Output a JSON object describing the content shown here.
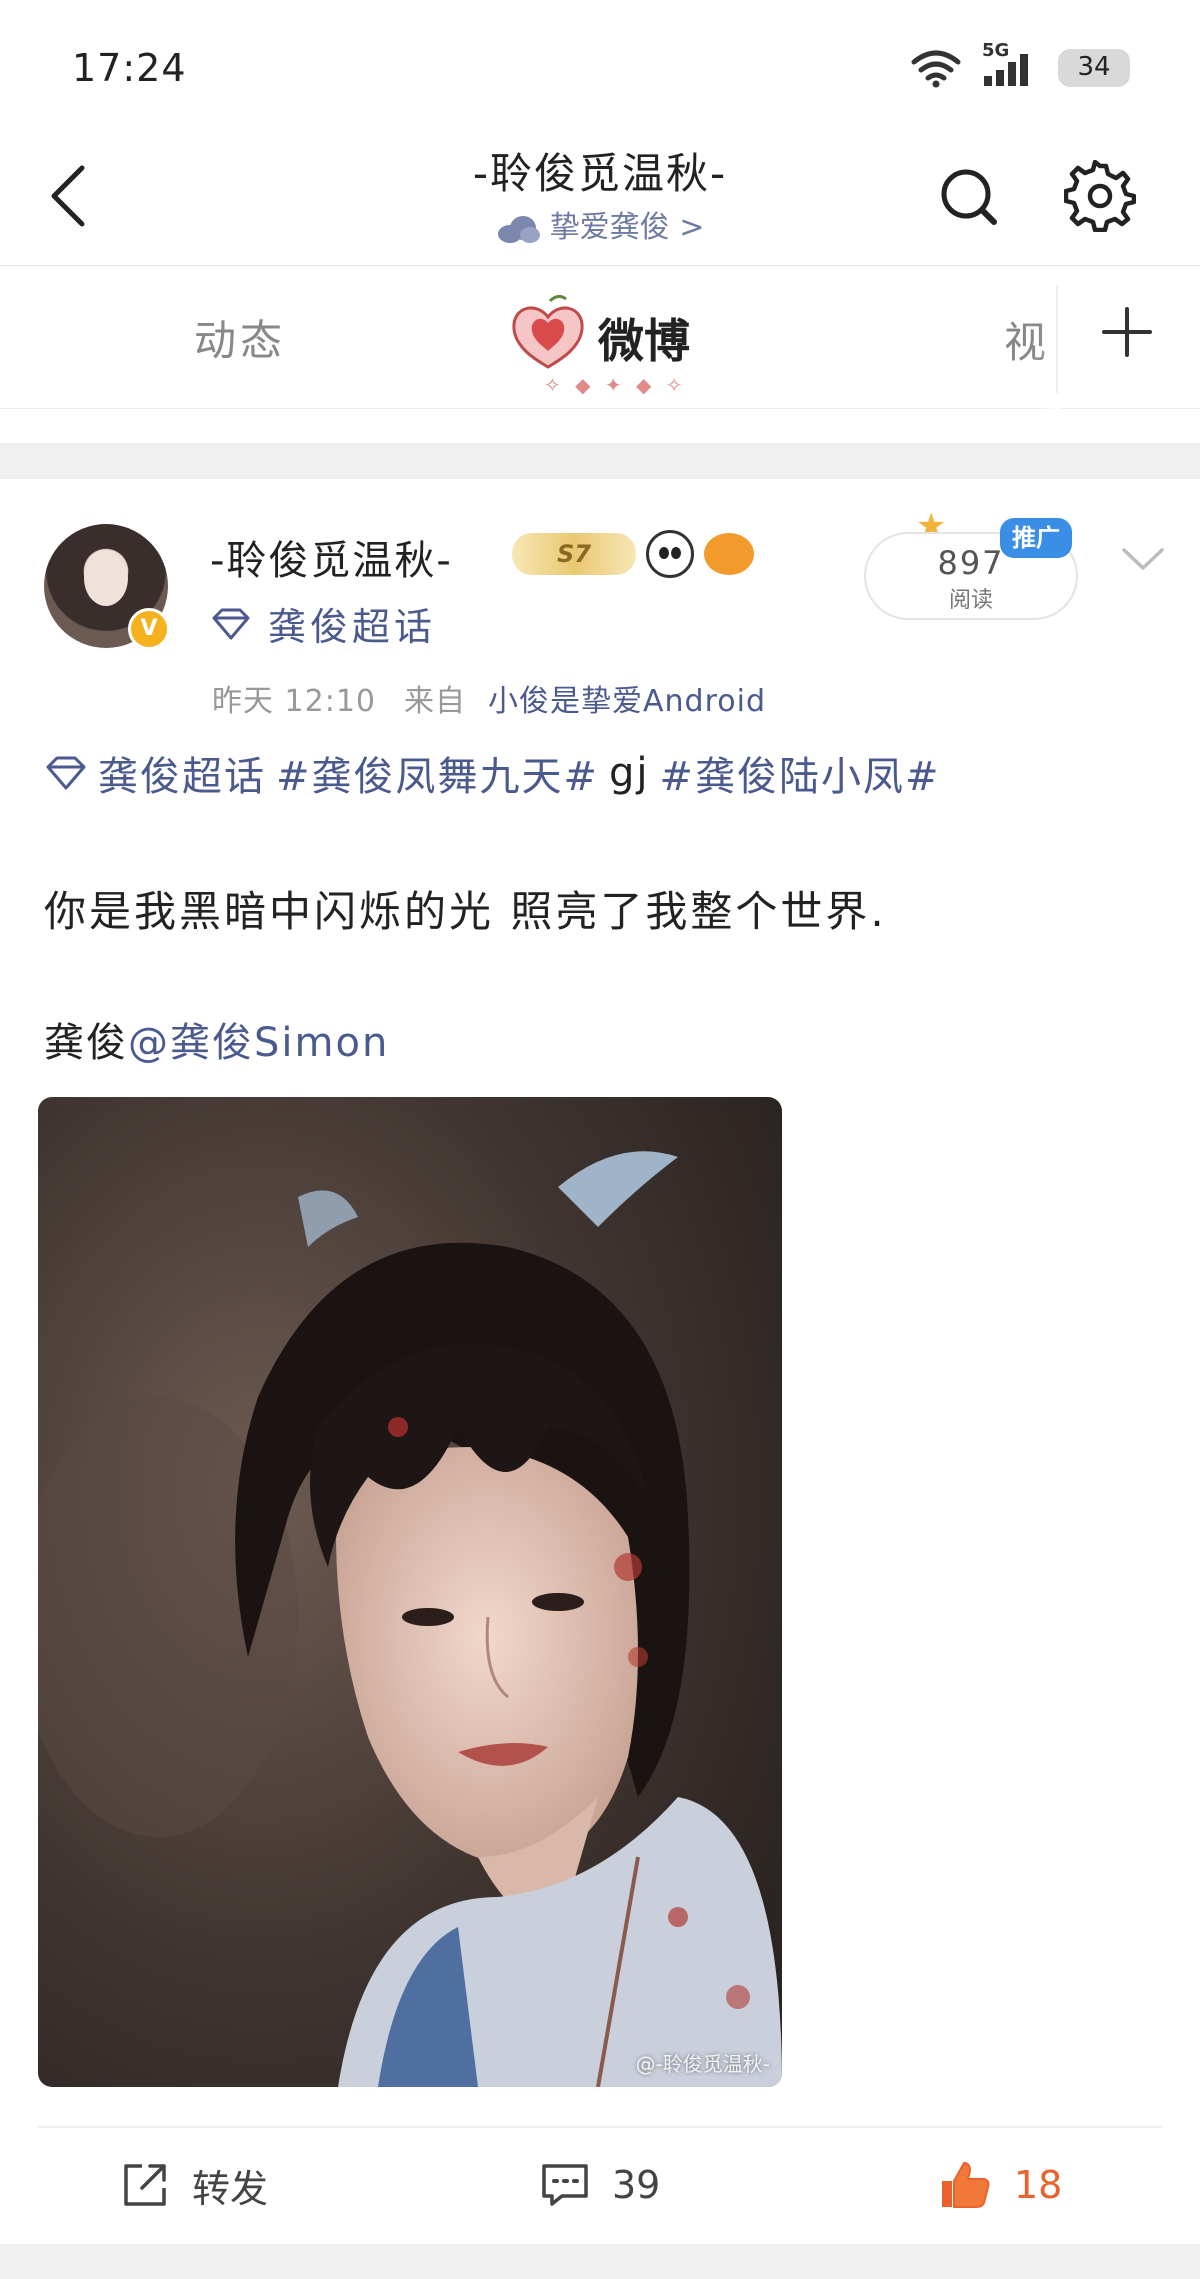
{
  "status_bar": {
    "time": "17:24",
    "network": "5G",
    "battery": "34"
  },
  "header": {
    "title": "-聆俊觅温秋-",
    "subtitle": "挚爱龚俊 >"
  },
  "tabs": [
    {
      "label": "动态"
    },
    {
      "label": "微博"
    },
    {
      "label": "视"
    }
  ],
  "post": {
    "author": "-聆俊觅温秋-",
    "level_badge": "S7",
    "super_topic": "龚俊超话",
    "reads": {
      "count": "897",
      "label": "阅读"
    },
    "promo_label": "推广",
    "time": "昨天 12:10",
    "from_label": "来自",
    "source": "小俊是挚爱Android",
    "tags": {
      "super_topic": "龚俊超话",
      "tag1": "#龚俊凤舞九天#",
      "plain": "gj",
      "tag2": "#龚俊陆小凤#"
    },
    "text": "你是我黑暗中闪烁的光 照亮了我整个世界.",
    "mention_prefix": "龚俊",
    "mention": "@龚俊Simon",
    "image_watermark": "@-聆俊觅温秋-"
  },
  "actions": {
    "repost_label": "转发",
    "comments": "39",
    "likes": "18"
  },
  "colors": {
    "link": "#4a5a8f",
    "like": "#e9622c",
    "promo": "#3b8ee6"
  }
}
